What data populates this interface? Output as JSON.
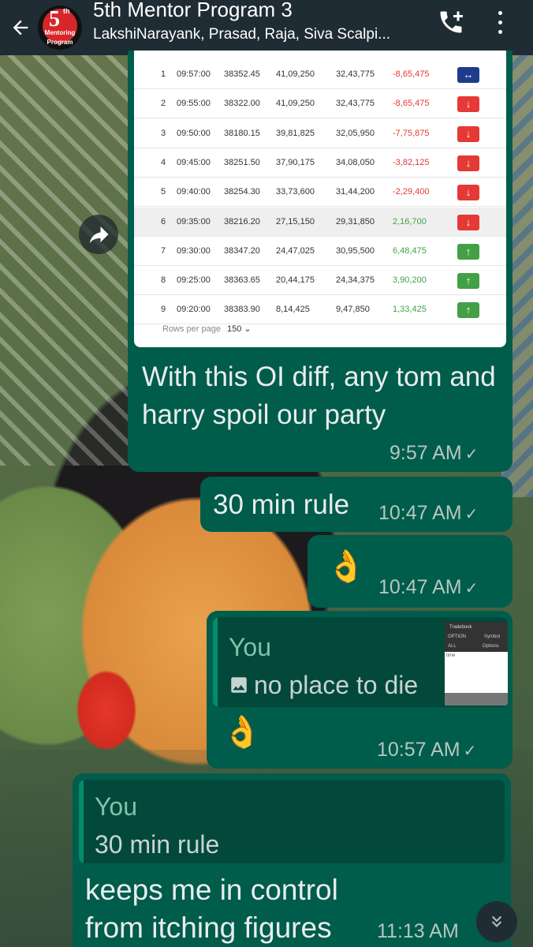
{
  "header": {
    "title": "5th Mentor Program 3",
    "subtitle": "LakshiNarayank, Prasad, Raja, Siva Scalpi...",
    "avatar": {
      "number": "5",
      "suffix": "th",
      "line1": "Mentoring",
      "line2": "Program"
    }
  },
  "icons": {
    "back": "arrow-left-icon",
    "call": "add-call-icon",
    "menu": "more-vert-icon",
    "forward": "forward-icon",
    "scroll": "double-chevron-down-icon"
  },
  "colors": {
    "outgoing_bubble": "#005c4b",
    "header": "#1f2c34",
    "red": "#e53935",
    "green": "#43a047",
    "blue": "#1e3c8c"
  },
  "oi_table": {
    "rows": [
      {
        "n": "1",
        "time": "09:57:00",
        "price": "38352.45",
        "c1": "41,09,250",
        "c2": "32,43,775",
        "diff": "-8,65,475",
        "signal": "↔",
        "signal_color": "blue",
        "diff_color": "red"
      },
      {
        "n": "2",
        "time": "09:55:00",
        "price": "38322.00",
        "c1": "41,09,250",
        "c2": "32,43,775",
        "diff": "-8,65,475",
        "signal": "↓",
        "signal_color": "red",
        "diff_color": "red"
      },
      {
        "n": "3",
        "time": "09:50:00",
        "price": "38180.15",
        "c1": "39,81,825",
        "c2": "32,05,950",
        "diff": "-7,75,875",
        "signal": "↓",
        "signal_color": "red",
        "diff_color": "red"
      },
      {
        "n": "4",
        "time": "09:45:00",
        "price": "38251.50",
        "c1": "37,90,175",
        "c2": "34,08,050",
        "diff": "-3,82,125",
        "signal": "↓",
        "signal_color": "red",
        "diff_color": "red"
      },
      {
        "n": "5",
        "time": "09:40:00",
        "price": "38254.30",
        "c1": "33,73,600",
        "c2": "31,44,200",
        "diff": "-2,29,400",
        "signal": "↓",
        "signal_color": "red",
        "diff_color": "red"
      },
      {
        "n": "6",
        "time": "09:35:00",
        "price": "38216.20",
        "c1": "27,15,150",
        "c2": "29,31,850",
        "diff": "2,16,700",
        "signal": "↓",
        "signal_color": "red",
        "diff_color": "green"
      },
      {
        "n": "7",
        "time": "09:30:00",
        "price": "38347.20",
        "c1": "24,47,025",
        "c2": "30,95,500",
        "diff": "6,48,475",
        "signal": "↑",
        "signal_color": "green",
        "diff_color": "green"
      },
      {
        "n": "8",
        "time": "09:25:00",
        "price": "38363.65",
        "c1": "20,44,175",
        "c2": "24,34,375",
        "diff": "3,90,200",
        "signal": "↑",
        "signal_color": "green",
        "diff_color": "green"
      },
      {
        "n": "9",
        "time": "09:20:00",
        "price": "38383.90",
        "c1": "8,14,425",
        "c2": "9,47,850",
        "diff": "1,33,425",
        "signal": "↑",
        "signal_color": "green",
        "diff_color": "green"
      }
    ],
    "rows_per_page_label": "Rows per page",
    "rows_per_page_value": "150"
  },
  "messages": [
    {
      "text": "With this OI diff, any tom and harry spoil our party",
      "time": "9:57 AM"
    },
    {
      "text": "30 min rule",
      "time": "10:47 AM"
    },
    {
      "text": "👌",
      "time": "10:47 AM"
    },
    {
      "quote_author": "You",
      "quote_text": "no place to die",
      "quote_thumb": {
        "title": "Tradebook",
        "opt1": "OPTION",
        "opt2": "ALL",
        "lbl1": "Symbol",
        "lbl2": "Options",
        "lbl3": "time"
      },
      "text": "👌",
      "time": "10:57 AM"
    },
    {
      "quote_author": "You",
      "quote_text": "30 min rule",
      "text": "keeps me in control from itching figures",
      "time": "11:13 AM"
    }
  ],
  "tick": "✓"
}
